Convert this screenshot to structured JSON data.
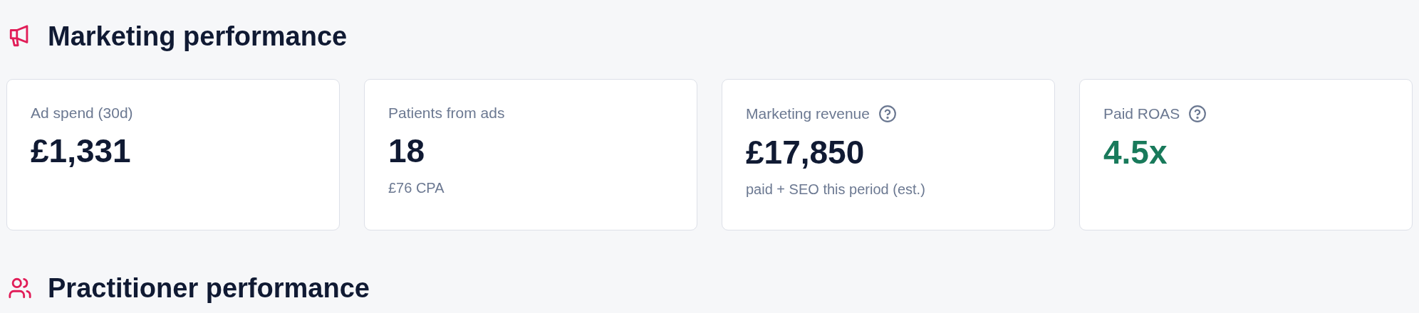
{
  "sections": [
    {
      "title": "Marketing performance",
      "cards": [
        {
          "label": "Ad spend (30d)",
          "help": false,
          "value": "£1,331",
          "positive": false
        },
        {
          "label": "Patients from ads",
          "help": false,
          "value": "18",
          "positive": false,
          "note": "£76 CPA"
        },
        {
          "label": "Marketing revenue",
          "help": true,
          "value": "£17,850",
          "positive": false,
          "note": "paid + SEO this period (est.)"
        },
        {
          "label": "Paid ROAS",
          "help": true,
          "value": "4.5x",
          "positive": true
        }
      ]
    },
    {
      "title": "Practitioner performance"
    }
  ]
}
